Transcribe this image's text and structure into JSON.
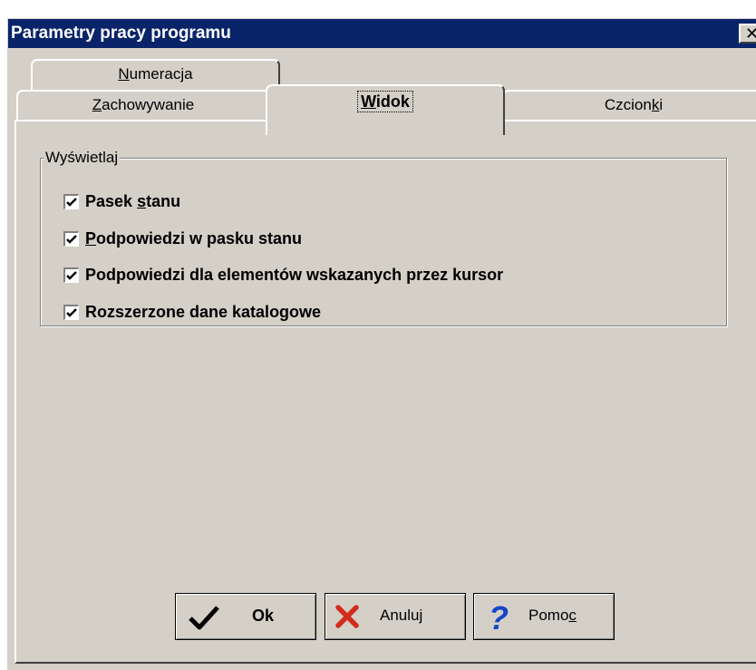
{
  "window": {
    "title": "Parametry pracy programu",
    "close_glyph": "✕"
  },
  "tabs": {
    "numeracja": {
      "pre": "",
      "key": "N",
      "post": "umeracja"
    },
    "zachowywanie": {
      "pre": "",
      "key": "Z",
      "post": "achowywanie"
    },
    "widok": {
      "pre": "",
      "key": "W",
      "post": "idok"
    },
    "czcionki": {
      "pre": "Czcion",
      "key": "k",
      "post": "i"
    }
  },
  "group": {
    "legend": "Wyświetlaj",
    "options": [
      {
        "pre": "Pasek ",
        "key": "s",
        "post": "tanu",
        "checked": true
      },
      {
        "pre": "",
        "key": "P",
        "post": "odpowiedzi w pasku stanu",
        "checked": true
      },
      {
        "pre": "Podpowiedzi dla elementów wskazanych przez kursor",
        "key": "",
        "post": "",
        "checked": true
      },
      {
        "pre": "Rozszerzone dane katalogowe",
        "key": "",
        "post": "",
        "checked": true
      }
    ]
  },
  "buttons": {
    "ok": {
      "label": "Ok",
      "icon": "checkmark-icon"
    },
    "anuluj": {
      "label": "Anuluj",
      "icon": "red-x-icon"
    },
    "pomoc": {
      "pre": "Pomo",
      "key": "c",
      "icon": "question-mark-icon"
    }
  },
  "colors": {
    "titlebar": "#0a246a",
    "face": "#d4d0c8",
    "cancel_icon": "#d32c1c",
    "help_icon": "#1546c8"
  }
}
